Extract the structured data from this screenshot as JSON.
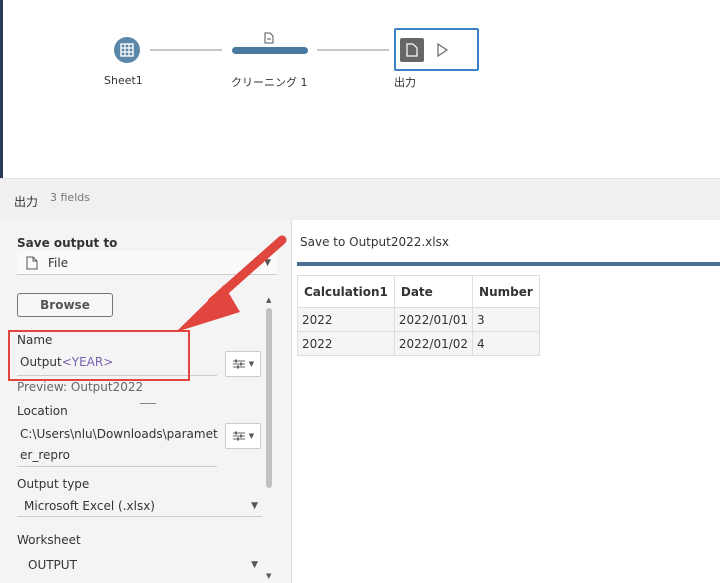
{
  "flow": {
    "nodes": [
      {
        "label": "Sheet1",
        "icon": "table-icon"
      },
      {
        "label": "クリーニング 1",
        "icon": "clean-step-icon"
      },
      {
        "label": "出力",
        "icon": "output-doc-icon"
      }
    ],
    "colors": {
      "input": "#5b87a8",
      "clean": "#4a7aa0",
      "selected": "#3a83c9"
    }
  },
  "band": {
    "title": "出力",
    "fields": "3 fields"
  },
  "left_panel": {
    "save_output_label": "Save output to",
    "save_output_value": "File",
    "browse_label": "Browse",
    "name_label": "Name",
    "name_value_prefix": "Output",
    "name_value_param": "<YEAR>",
    "preview": "Preview: Output2022",
    "location_label": "Location",
    "location_line1": "C:\\Users\\nlu\\Downloads\\paramet",
    "location_line2": "er_repro",
    "output_type_label": "Output type",
    "output_type_value": "Microsoft Excel (.xlsx)",
    "worksheet_label": "Worksheet",
    "worksheet_value": "OUTPUT"
  },
  "right_panel": {
    "header": "Save to Output2022.xlsx",
    "columns": [
      "Calculation1",
      "Date",
      "Number"
    ],
    "rows": [
      [
        "2022",
        "2022/01/01",
        "3"
      ],
      [
        "2022",
        "2022/01/02",
        "4"
      ]
    ]
  },
  "annotation": {
    "color": "#e0463e"
  }
}
